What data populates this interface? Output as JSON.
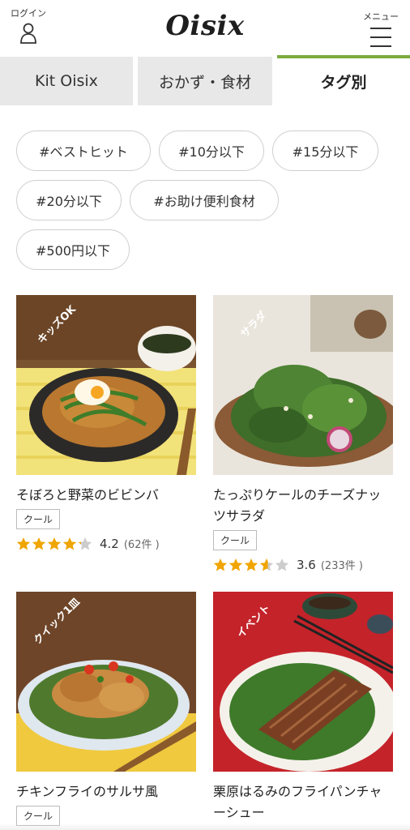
{
  "header": {
    "login_label": "ログイン",
    "logo": "Oisix",
    "menu_label": "メニュー"
  },
  "tabs": [
    {
      "label": "Kit Oisix",
      "active": false
    },
    {
      "label": "おかず・食材",
      "active": false
    },
    {
      "label": "タグ別",
      "active": true
    }
  ],
  "tags": [
    "#ベストヒット",
    "#10分以下",
    "#15分以下",
    "#20分以下",
    "#お助け便利食材",
    "#500円以下"
  ],
  "colors": {
    "accent_green": "#7bab3e",
    "star": "#f0a500",
    "star_empty": "#cccccc",
    "ribbon_yellow": "#f5c400",
    "ribbon_green": "#3aa34a",
    "ribbon_orange": "#e8531c",
    "ribbon_brown": "#8a5a3c"
  },
  "products": [
    {
      "title": "そぼろと野菜のビビンバ",
      "ribbon": "キッズOK",
      "ribbon_color": "#f5c400",
      "badge": "クール",
      "rating": 4.2,
      "rating_text": "4.2",
      "count_text": "(62件 )"
    },
    {
      "title": "たっぷりケールのチーズナッツサラダ",
      "ribbon": "サラダ",
      "ribbon_color": "#3aa34a",
      "badge": "クール",
      "rating": 3.6,
      "rating_text": "3.6",
      "count_text": "(233件 )"
    },
    {
      "title": "チキンフライのサルサ風",
      "ribbon": "クイック1皿",
      "ribbon_color": "#e8531c",
      "badge": "クール",
      "rating": null,
      "rating_text": null,
      "count_text": null
    },
    {
      "title": "栗原はるみのフライパンチャーシュー",
      "ribbon": "イベント",
      "ribbon_color": "#8a5a3c",
      "badge": null,
      "rating": null,
      "rating_text": null,
      "count_text": null
    }
  ]
}
